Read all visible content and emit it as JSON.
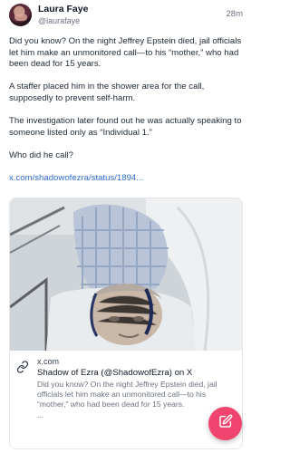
{
  "author": {
    "name": "Laura Faye",
    "handle": "@laurafaye",
    "time": "28m"
  },
  "post": {
    "paragraphs": [
      "Did you know? On the night Jeffrey Epstein died, jail officials let him make an unmonitored call—to his “mother,” who had been dead for 15 years.",
      "A staffer placed him in the shower area for the call, supposedly to prevent self-harm.",
      "The investigation later found out he was actually speaking to someone listed only as “Individual 1.”",
      "Who did he call?"
    ],
    "link_text": "x.com/shadowofezra/status/1894..."
  },
  "card": {
    "domain": "x.com",
    "title": "Shadow of Ezra (@ShadowofEzra) on X",
    "description": "Did you know? On the night Jeffrey Epstein died, jail officials let him make an unmonitored call—to his “mother,” who had been dead for 15 years.",
    "ellipsis": "..."
  },
  "icons": {
    "link": "link-icon",
    "compose": "compose-icon"
  },
  "colors": {
    "link": "#2f6cd6",
    "fab": "#f0446e"
  }
}
